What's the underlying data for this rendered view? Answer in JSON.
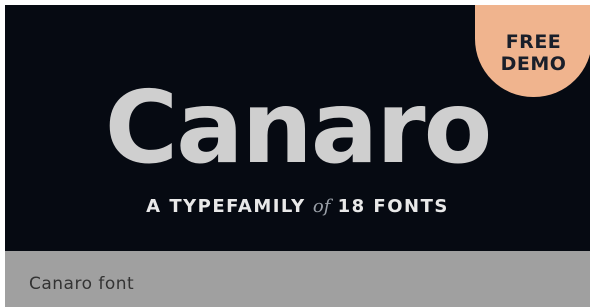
{
  "badge": {
    "line1": "FREE",
    "line2": "DEMO",
    "color": "#f0b48e"
  },
  "banner": {
    "title": "Canaro",
    "subtitle_part1": "A TYPEFAMILY",
    "subtitle_of": "of",
    "subtitle_part2": "18 FONTS",
    "background": "#060a12"
  },
  "caption": {
    "text": "Canaro font"
  }
}
